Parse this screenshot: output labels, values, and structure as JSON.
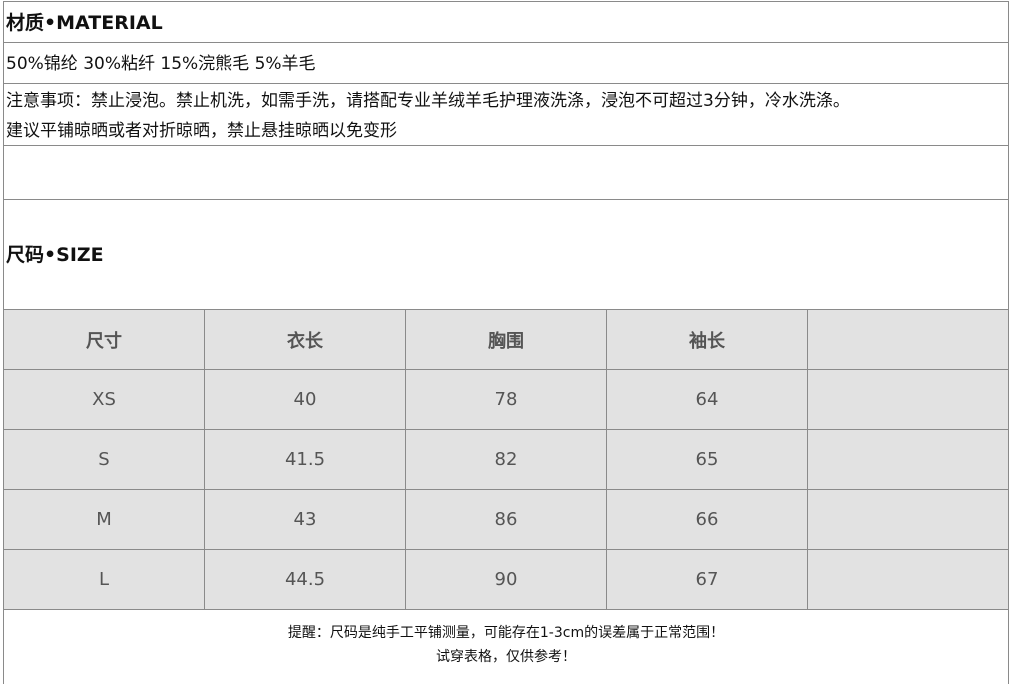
{
  "material": {
    "heading": "材质•MATERIAL",
    "composition": "50%锦纶 30%粘纤 15%浣熊毛 5%羊毛",
    "care_line1": "注意事项：禁止浸泡。禁止机洗，如需手洗，请搭配专业羊绒羊毛护理液洗涤，浸泡不可超过3分钟，冷水洗涤。",
    "care_line2": "建议平铺晾晒或者对折晾晒，禁止悬挂晾晒以免变形"
  },
  "size": {
    "heading": "尺码•SIZE",
    "table": {
      "headers": [
        "尺寸",
        "衣长",
        "胸围",
        "袖长",
        ""
      ],
      "rows": [
        [
          "XS",
          "40",
          "78",
          "64",
          ""
        ],
        [
          "S",
          "41.5",
          "82",
          "65",
          ""
        ],
        [
          "M",
          "43",
          "86",
          "66",
          ""
        ],
        [
          "L",
          "44.5",
          "90",
          "67",
          ""
        ]
      ]
    }
  },
  "note": {
    "line1": "提醒：尺码是纯手工平铺测量，可能存在1-3cm的误差属于正常范围！",
    "line2": "试穿表格，仅供参考！"
  },
  "colors": {
    "table_bg": "#e2e2e2",
    "border": "#8a8a8a",
    "table_text": "#555555"
  }
}
